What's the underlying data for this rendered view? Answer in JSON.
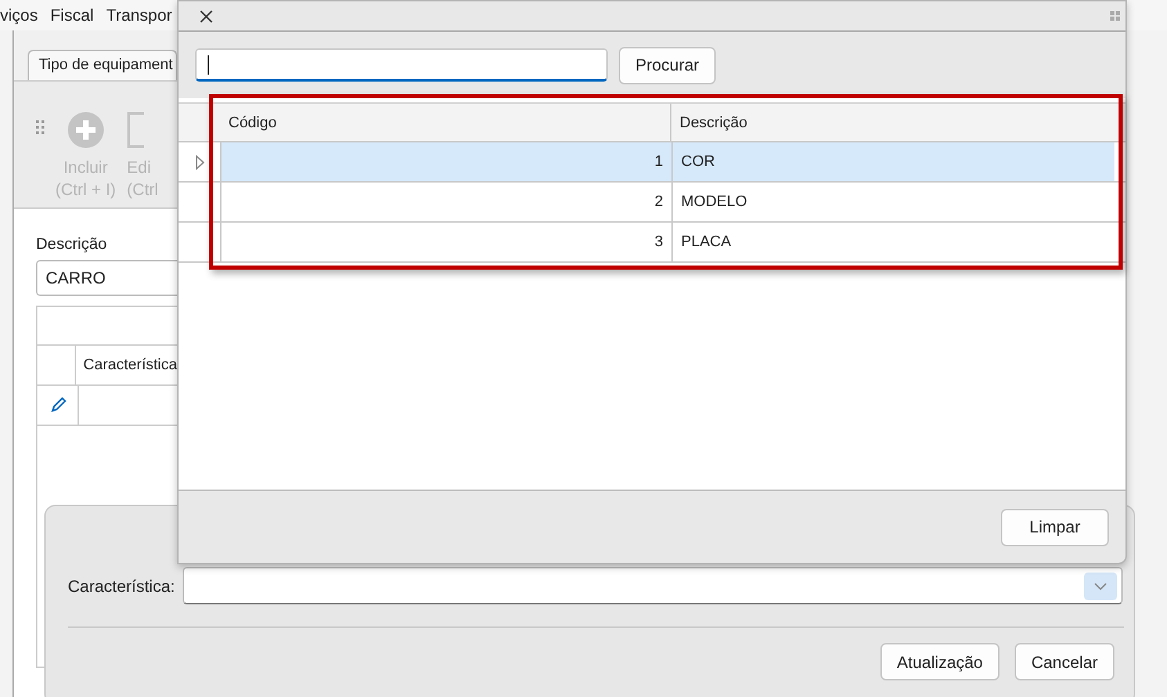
{
  "menu": [
    {
      "label": "viços"
    },
    {
      "label": "Fiscal"
    },
    {
      "label": "Transpor"
    }
  ],
  "tab": {
    "label": "Tipo de equipament",
    "selected": true
  },
  "toolbar": [
    {
      "kind": "add",
      "label": "Incluir",
      "shortcut": "(Ctrl + I)",
      "disabled": true
    },
    {
      "kind": "edit",
      "label": "Edi",
      "shortcut": "(Ctrl",
      "disabled": true
    }
  ],
  "form": {
    "label": "Descrição",
    "value": "CARRO"
  },
  "grid": {
    "columns": [
      "Característica"
    ]
  },
  "panel": {
    "label": "Característica:",
    "buttons": [
      "Atualização",
      "Cancelar"
    ]
  },
  "dialog": {
    "search_button": "Procurar",
    "columns": [
      "Código",
      "Descrição"
    ],
    "rows": [
      {
        "code": "1",
        "description": "COR",
        "selected": true
      },
      {
        "code": "2",
        "description": "MODELO",
        "selected": false
      },
      {
        "code": "3",
        "description": "PLACA",
        "selected": false
      }
    ],
    "footer_button": "Limpar"
  }
}
